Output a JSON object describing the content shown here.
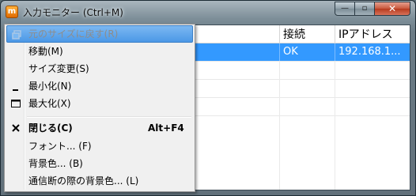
{
  "window": {
    "app_icon_glyph": "m",
    "title": "入力モニター (Ctrl+M)",
    "buttons": {
      "minimize": "—",
      "maximize": "▫",
      "close": "✕"
    }
  },
  "table": {
    "headers": [
      "接続",
      "IPアドレス"
    ],
    "selected_row": [
      "OK",
      "192.168.1..."
    ]
  },
  "menu": {
    "items": [
      {
        "label": "元のサイズに戻す(R)",
        "icon": "restore-icon",
        "state": "disabled-highlighted"
      },
      {
        "label": "移動(M)"
      },
      {
        "label": "サイズ変更(S)"
      },
      {
        "label": "最小化(N)",
        "icon": "minimize-icon"
      },
      {
        "label": "最大化(X)",
        "icon": "maximize-icon"
      },
      {
        "label": "閉じる(C)",
        "icon": "close-icon",
        "accelerator": "Alt+F4",
        "bold": true
      },
      {
        "label": "フォント... (F)"
      },
      {
        "label": "背景色... (B)"
      },
      {
        "label": "通信断の際の背景色... (L)"
      }
    ]
  },
  "colors": {
    "selection": "#3399ff",
    "menu_highlight": "#4b98e6"
  }
}
